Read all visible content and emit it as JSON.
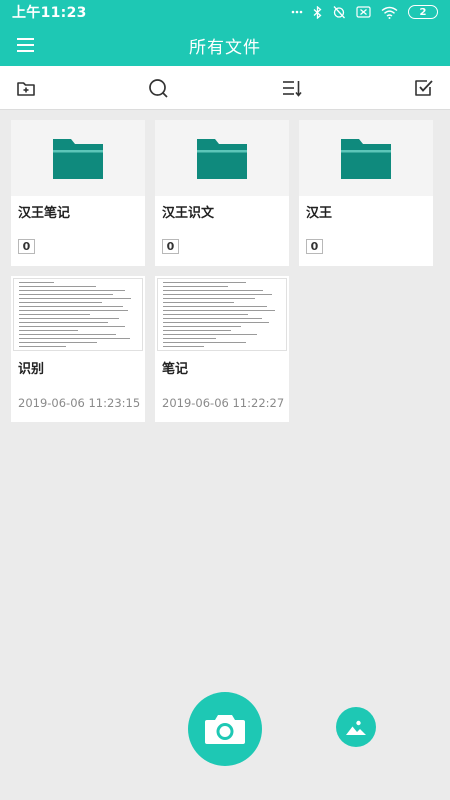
{
  "status_bar": {
    "time": "上午11:23",
    "battery": "2",
    "icons": [
      "dots-icon",
      "bluetooth-icon",
      "no-alarm-icon",
      "sim-off-icon",
      "wifi-icon",
      "battery-icon"
    ]
  },
  "app_bar": {
    "title": "所有文件",
    "menu_icon": "menu-icon"
  },
  "toolbar": {
    "icons": [
      "new-folder-icon",
      "search-icon",
      "sort-icon",
      "multi-select-icon"
    ]
  },
  "folders": [
    {
      "name": "汉王笔记",
      "count": "0",
      "icon": "folder-icon"
    },
    {
      "name": "汉王识文",
      "count": "0",
      "icon": "folder-icon"
    },
    {
      "name": "汉王",
      "count": "0",
      "icon": "folder-icon"
    }
  ],
  "documents": [
    {
      "name": "识别",
      "date": "2019-06-06 11:23:15"
    },
    {
      "name": "笔记",
      "date": "2019-06-06 11:22:27"
    }
  ],
  "actions": {
    "camera_icon": "camera-icon",
    "gallery_icon": "gallery-icon"
  },
  "colors": {
    "primary": "#1ec8b4",
    "folder": "#0f8a7d",
    "background": "#ebebeb"
  }
}
